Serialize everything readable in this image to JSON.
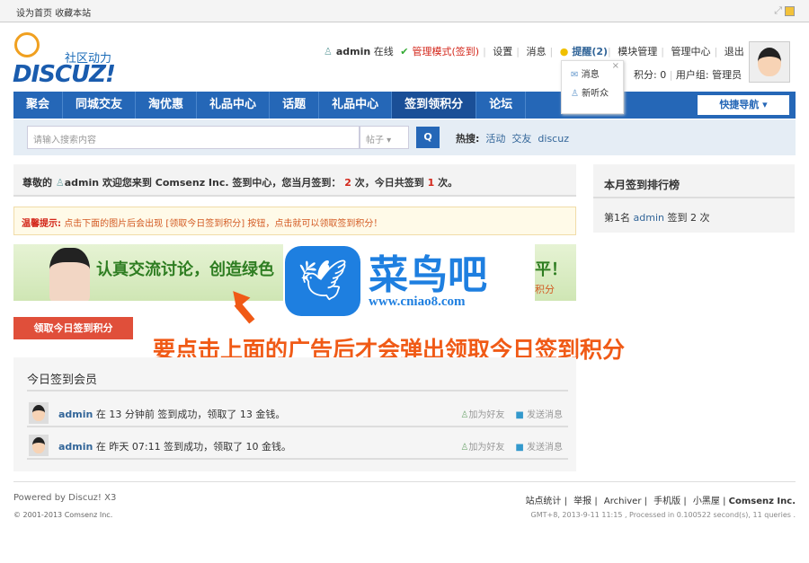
{
  "topbar": {
    "set_home": "设为首页",
    "favorite": "收藏本站"
  },
  "logo": {
    "slogan": "社区动力",
    "word": "DISCUZ!"
  },
  "userbar": {
    "username": "admin",
    "status": "在线",
    "admin_mode": "管理模式(签到)",
    "settings": "设置",
    "messages": "消息",
    "reminders": "提醒(2)",
    "portal_admin": "模块管理",
    "admin_center": "管理中心",
    "logout": "退出",
    "credits": "积分: 0",
    "usergroup": "用户组: 管理员"
  },
  "popup": {
    "message": "消息",
    "new_listener": "新听众",
    "close": "×"
  },
  "nav": {
    "items": [
      "聚会",
      "同城交友",
      "淘优惠",
      "礼品中心",
      "话题",
      "礼品中心",
      "签到领积分",
      "论坛"
    ],
    "active": 6,
    "quick": "快捷导航 ▾"
  },
  "search": {
    "placeholder": "请输入搜索内容",
    "type": "帖子 ▾",
    "button": "Q",
    "hot_label": "热搜:",
    "hot": [
      "活动",
      "交友",
      "discuz"
    ]
  },
  "welcome": {
    "prefix": "尊敬的",
    "user": "admin",
    "middle": "欢迎您来到 Comsenz Inc. 签到中心，您当月签到：",
    "month_count": "2",
    "unit1": "次，今日共签到",
    "today_count": "1",
    "unit2": "次。"
  },
  "notice": {
    "label": "温馨提示:",
    "text": "点击下面的图片后会出现 [领取今日签到积分] 按钮，点击就可以领取签到积分！"
  },
  "banner": {
    "text": "认真交流讨论，创造绿色",
    "tail": "平！",
    "tail2": "积分"
  },
  "watermark": {
    "name": "菜鸟吧",
    "url": "www.cniao8.com"
  },
  "claim_button": "领取今日签到积分",
  "annotation": "要点击上面的广告后才会弹出领取今日签到积分",
  "today": {
    "title": "今日签到会员",
    "rows": [
      {
        "user": "admin",
        "text": "在 13 分钟前 签到成功，领取了 13 金钱。",
        "add_friend": "加为好友",
        "send_msg": "发送消息"
      },
      {
        "user": "admin",
        "text": "在 昨天 07:11 签到成功，领取了 10 金钱。",
        "add_friend": "加为好友",
        "send_msg": "发送消息"
      }
    ]
  },
  "rank": {
    "title": "本月签到排行榜",
    "prefix": "第1名",
    "user": "admin",
    "suffix": "签到 2 次"
  },
  "footer": {
    "powered": "Powered by Discuz! X3",
    "copyright": "© 2001-2013 Comsenz Inc.",
    "links": [
      "站点统计",
      "举报",
      "Archiver",
      "手机版",
      "小黑屋",
      "Comsenz Inc."
    ],
    "gmt": "GMT+8, 2013-9-11 11:15 , Processed in 0.100522 second(s), 11 queries ."
  }
}
